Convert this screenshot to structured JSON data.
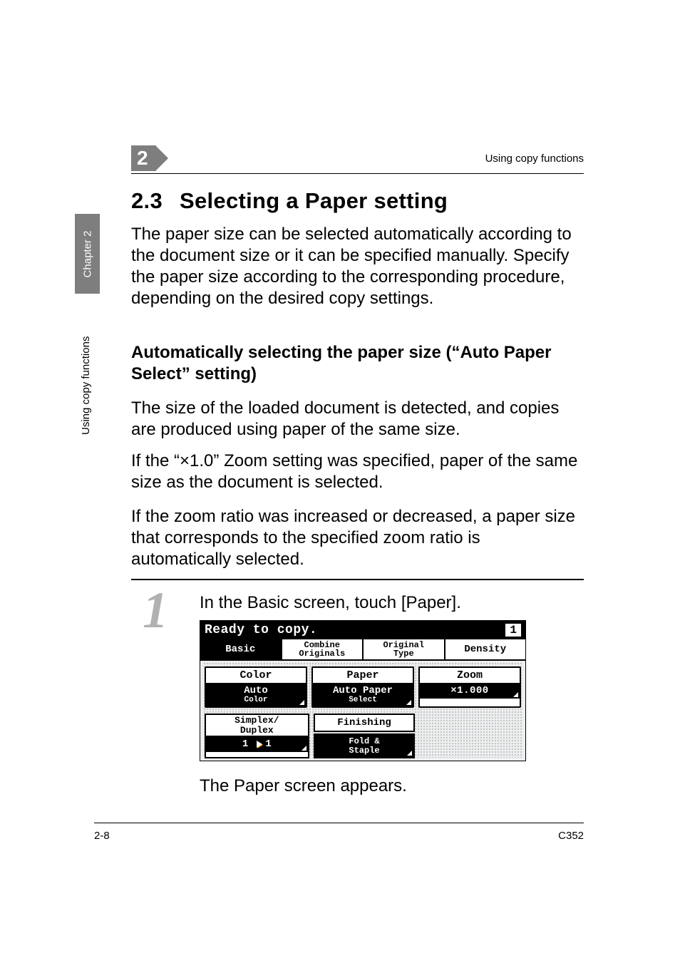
{
  "header": {
    "chapter_num": "2",
    "running_head": "Using copy functions"
  },
  "side": {
    "chapter_label": "Chapter 2",
    "section_label": "Using copy functions"
  },
  "section": {
    "number": "2.3",
    "title": "Selecting a Paper setting"
  },
  "paragraphs": {
    "p1": "The paper size can be selected automatically according to the document size or it can be specified manually. Specify the paper size according to the corresponding procedure, depending on the desired copy settings.",
    "subhead": "Automatically selecting the paper size (“Auto Paper Select” setting)",
    "p2": "The size of the loaded document is detected, and copies are produced using paper of the same size.",
    "p3": "If the “×1.0” Zoom setting was specified, paper of the same size as the document is selected.",
    "p4": "If the zoom ratio was increased or decreased, a paper size that corresponds to the specified zoom ratio is automatically selected."
  },
  "step": {
    "number": "1",
    "text": "In the Basic screen, touch [Paper].",
    "followup": "The Paper screen appears."
  },
  "lcd": {
    "title": "Ready to copy.",
    "copies": "1",
    "tabs": {
      "basic": "Basic",
      "combine_top": "Combine",
      "combine_bottom": "Originals",
      "original_top": "Original",
      "original_bottom": "Type",
      "density": "Density"
    },
    "cells": {
      "color": {
        "label": "Color",
        "value_top": "Auto",
        "value_bottom": "Color"
      },
      "paper": {
        "label": "Paper",
        "value_top": "Auto Paper",
        "value_bottom": "Select"
      },
      "zoom": {
        "label": "Zoom",
        "value": "×1.000"
      },
      "simplex": {
        "label_top": "Simplex/",
        "label_bottom": "Duplex",
        "left": "1",
        "right": "1"
      },
      "finishing": {
        "label": "Finishing",
        "sub_top": "Fold &",
        "sub_bottom": "Staple"
      }
    }
  },
  "footer": {
    "page": "2-8",
    "model": "C352"
  }
}
